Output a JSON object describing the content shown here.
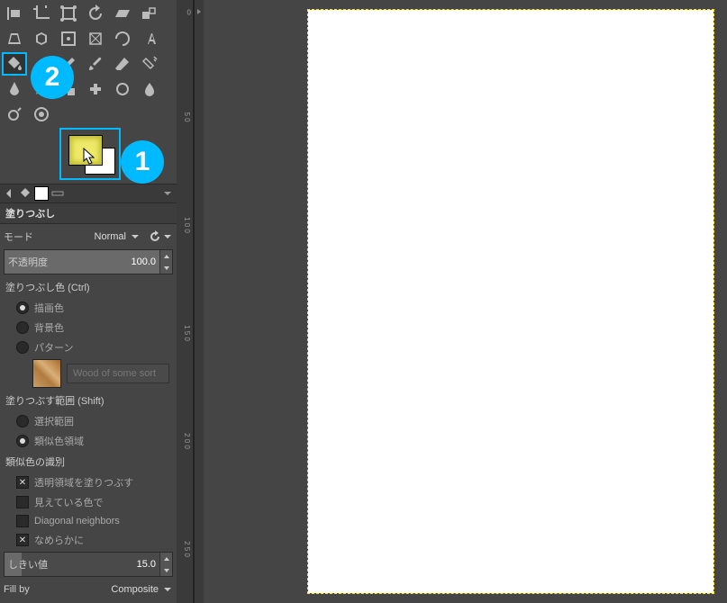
{
  "tool_title": "塗りつぶし",
  "mode": {
    "label": "モード",
    "value": "Normal"
  },
  "opacity": {
    "label": "不透明度",
    "value": "100.0"
  },
  "fill_color": {
    "header": "塗りつぶし色 (Ctrl)",
    "options": {
      "fg": "描画色",
      "bg": "背景色",
      "pattern": "パターン"
    },
    "selected": "fg",
    "pattern_name": "Wood of some sort"
  },
  "fill_range": {
    "header": "塗りつぶす範囲 (Shift)",
    "options": {
      "selection": "選択範囲",
      "similar": "類似色領域"
    },
    "selected": "similar"
  },
  "similar_colors": {
    "header": "類似色の識別",
    "fill_transparent": {
      "label": "透明領域を塗りつぶす",
      "checked": true
    },
    "visible_color": {
      "label": "見えている色で",
      "checked": false
    },
    "diagonal": {
      "label": "Diagonal neighbors",
      "checked": false
    },
    "smooth": {
      "label": "なめらかに",
      "checked": true
    }
  },
  "threshold": {
    "label": "しきい値",
    "value": "15.0"
  },
  "fill_by": {
    "label": "Fill by",
    "value": "Composite"
  },
  "ruler_ticks": [
    "0",
    "5 0",
    "1 0 0",
    "1 5 0",
    "2 0 0",
    "2 5 0"
  ],
  "annotations": {
    "a1": "1",
    "a2": "2"
  }
}
